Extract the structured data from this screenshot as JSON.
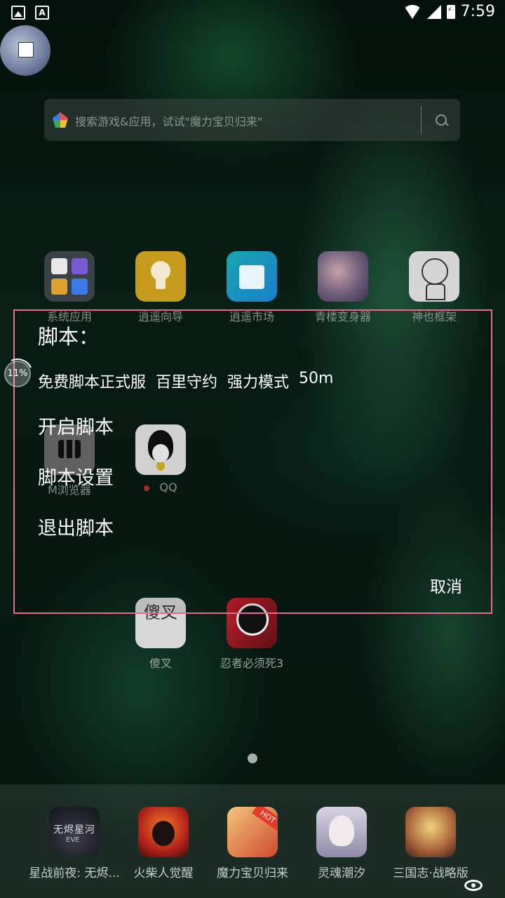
{
  "status_bar": {
    "time": "7:59"
  },
  "search": {
    "placeholder": "搜索游戏&应用，试试\"魔力宝贝归来\""
  },
  "apps_row1": [
    {
      "label": "系统应用",
      "icon": "system-apps-icon"
    },
    {
      "label": "逍遥向导",
      "icon": "lightbulb-icon"
    },
    {
      "label": "逍遥市场",
      "icon": "store-bag-icon"
    },
    {
      "label": "青楼变身器",
      "icon": "anime-girl-icon"
    },
    {
      "label": "神也框架",
      "icon": "sketch-character-icon"
    }
  ],
  "apps_row2": [
    {
      "label": "M浏览器",
      "icon": "m-browser-icon"
    },
    {
      "label": "QQ",
      "icon": "qq-penguin-icon"
    }
  ],
  "apps_row3": [
    {
      "label": "傻叉",
      "icon_text": "傻叉"
    },
    {
      "label": "忍者必须死3",
      "icon": "ninja-icon"
    }
  ],
  "dock": [
    {
      "label": "星战前夜: 无烬...",
      "icon": "eve-icon"
    },
    {
      "label": "火柴人觉醒",
      "icon": "stickman-icon"
    },
    {
      "label": "魔力宝贝归来",
      "icon": "crossgate-icon"
    },
    {
      "label": "灵魂潮汐",
      "icon": "soul-tide-icon"
    },
    {
      "label": "三国志·战略版",
      "icon": "three-kingdoms-icon"
    }
  ],
  "progress": {
    "value_percent": 11,
    "label": "11%"
  },
  "dialog": {
    "title": "脚本：",
    "info": [
      "免费脚本正式服",
      "百里守约",
      "强力模式",
      "50m"
    ],
    "items": [
      "开启脚本",
      "脚本设置",
      "退出脚本"
    ],
    "cancel": "取消"
  },
  "colors": {
    "dialog_border": "#e96a8c",
    "notification_dot": "#c0302a"
  }
}
